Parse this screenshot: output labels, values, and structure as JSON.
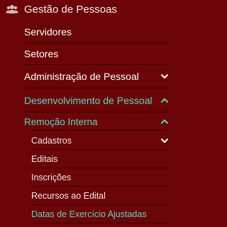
{
  "sidebar": {
    "module": {
      "title": "Gestão de Pessoas",
      "icon": "users-icon"
    },
    "items": [
      {
        "label": "Servidores"
      },
      {
        "label": "Setores"
      },
      {
        "label": "Administração de Pessoal",
        "icon": "chevron-down-icon"
      },
      {
        "label": "Desenvolvimento de Pessoal",
        "icon": "chevron-up-icon"
      }
    ],
    "submenu": {
      "label": "Remoção Interna",
      "icon": "chevron-up-icon",
      "items": [
        {
          "label": "Cadastros",
          "icon": "chevron-down-icon"
        },
        {
          "label": "Editais"
        },
        {
          "label": "Inscrições"
        },
        {
          "label": "Recursos ao Edital"
        },
        {
          "label": "Datas de Exercício Ajustadas"
        }
      ]
    }
  },
  "colors": {
    "background": "#6b0507",
    "text": "#ffffff",
    "accent": "#5fd3c3",
    "divider": "#3d0203"
  }
}
